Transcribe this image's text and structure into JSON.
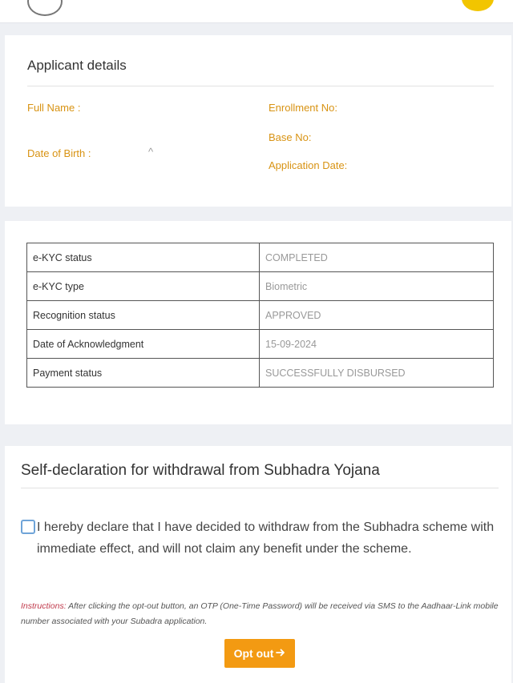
{
  "applicant": {
    "title": "Applicant details",
    "full_name_label": "Full Name :",
    "dob_label": "Date of Birth :",
    "dob_value": "^",
    "enrollment_label": "Enrollment No:",
    "base_label": "Base No:",
    "application_date_label": "Application Date:"
  },
  "status": {
    "rows": [
      {
        "key": "e-KYC status",
        "value": "COMPLETED"
      },
      {
        "key": "e-KYC type",
        "value": "Biometric"
      },
      {
        "key": "Recognition status",
        "value": "APPROVED"
      },
      {
        "key": "Date of Acknowledgment",
        "value": "15-09-2024"
      },
      {
        "key": "Payment status",
        "value": "SUCCESSFULLY DISBURSED"
      }
    ]
  },
  "declaration": {
    "title": "Self-declaration for withdrawal from Subhadra Yojana",
    "checkbox_checked": false,
    "text": "I hereby declare that I have decided to withdraw from the Subhadra scheme with immediate effect, and will not claim any benefit under the scheme.",
    "instructions_label": "Instructions:",
    "instructions_text": "After clicking the opt-out button, an OTP (One-Time Password) will be received via SMS to the Aadhaar-Link mobile number associated with your Subadra application.",
    "button_label": "Opt out",
    "button_icon": "arrow-right-icon"
  },
  "colors": {
    "accent": "#f39a12",
    "label": "#d89313",
    "checkbox_border": "#6fa4d8",
    "instructions_label": "#c0394b"
  }
}
